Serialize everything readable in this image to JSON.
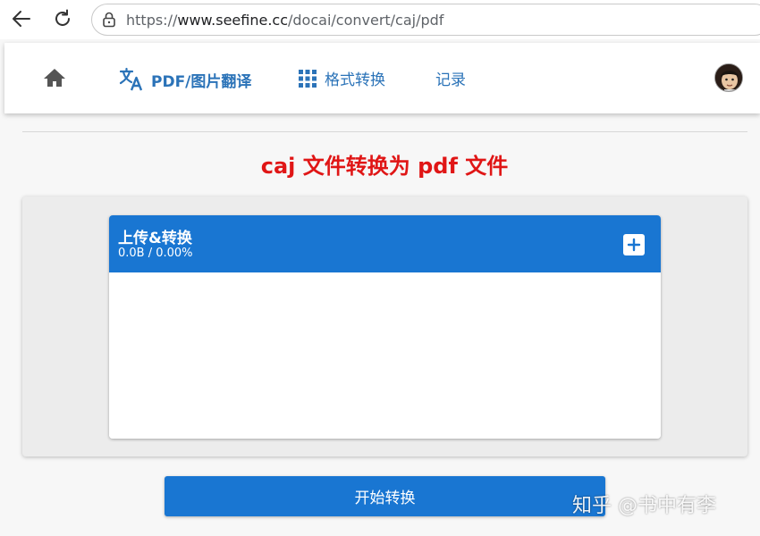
{
  "browser": {
    "url_scheme": "https://",
    "url_host": "www.seefine.cc",
    "url_path": "/docai/convert/caj/pdf"
  },
  "header": {
    "nav": {
      "translate_label": "PDF/图片翻译",
      "convert_label": "格式转换",
      "records_label": "记录"
    },
    "accent_color": "#2b73b8"
  },
  "main": {
    "title": "caj 文件转换为 pdf 文件",
    "title_color": "#e01616",
    "upload": {
      "title": "上传&转换",
      "progress": "0.0B / 0.00%"
    },
    "start_button_label": "开始转换",
    "button_color": "#1976d2"
  },
  "watermark": {
    "text": "知乎 @书中有李"
  },
  "icons": [
    "back-arrow-icon",
    "reload-icon",
    "lock-icon",
    "home-icon",
    "translate-icon",
    "grid-icon",
    "avatar",
    "plus-icon"
  ]
}
